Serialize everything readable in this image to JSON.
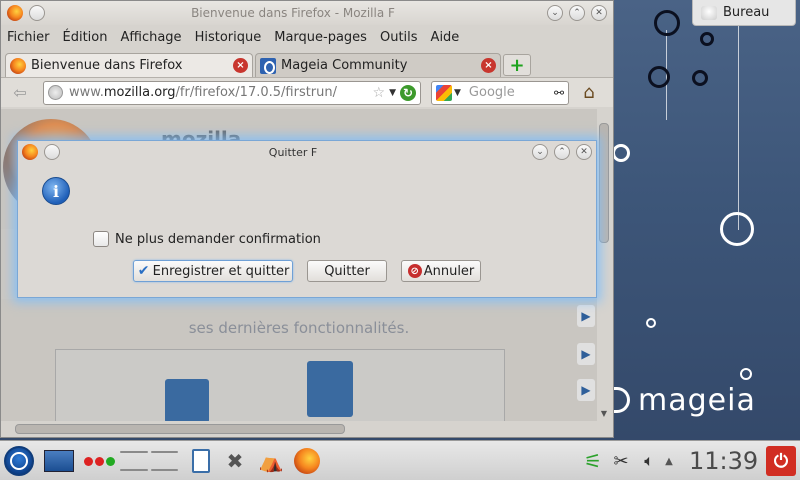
{
  "desktop": {
    "wallpaper_brand": "mageia",
    "tooltip": "Bureau"
  },
  "firefox": {
    "window_title": "Bienvenue dans Firefox - Mozilla F",
    "menu": [
      "Fichier",
      "Édition",
      "Affichage",
      "Historique",
      "Marque-pages",
      "Outils",
      "Aide"
    ],
    "tabs": [
      {
        "label": "Bienvenue dans Firefox",
        "active": true
      },
      {
        "label": "Mageia Community",
        "active": false
      }
    ],
    "url": {
      "prefix": "www.",
      "host": "mozilla.org",
      "path": "/fr/firefox/17.0.5/firstrun/"
    },
    "search_engine": "Google",
    "page": {
      "brand_text": "mozilla",
      "features_text": "ses dernières fonctionnalités."
    }
  },
  "dialog": {
    "title": "Quitter F",
    "icon": "info-icon",
    "checkbox_label": "Ne plus demander confirmation",
    "checkbox_checked": false,
    "buttons": {
      "save_quit": "Enregistrer et quitter",
      "quit": "Quitter",
      "cancel": "Annuler"
    }
  },
  "taskbar": {
    "clock": "11:39",
    "launchers": [
      "k-menu-icon",
      "show-desktop-icon",
      "activities-icon",
      "pager",
      "notes-icon",
      "settings-icon",
      "installer-icon",
      "firefox-icon"
    ],
    "tray": [
      "wifi-icon",
      "clipboard-icon",
      "volume-icon",
      "tray-expand-icon",
      "power-icon"
    ]
  },
  "colors": {
    "dialog_glow": "#78beff",
    "power_button": "#d12d22",
    "tab_close": "#c8362e"
  }
}
